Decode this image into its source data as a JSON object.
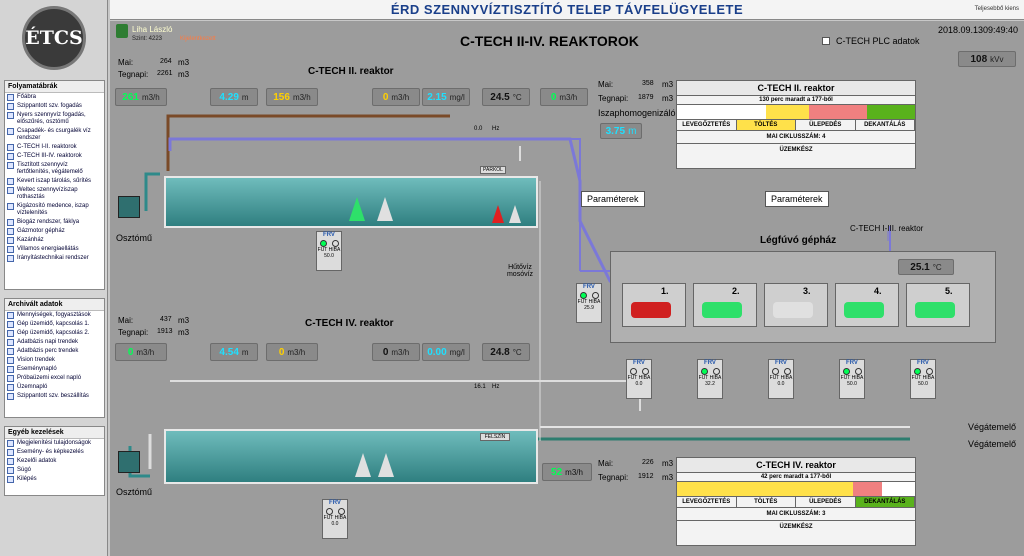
{
  "header": {
    "title": "ÉRD SZENNYVÍZTISZTÍTÓ TELEP TÁVFELÜGYELETE",
    "logout": "Teljesebbő kiens"
  },
  "sidebar": {
    "logo": "ÉTCS",
    "flow": {
      "title": "Folyamatábrák",
      "items": [
        "Főábra",
        "Szippantott szv. fogadás",
        "Nyers szennyvíz fogadás, előszűrés, osztómű",
        "Csapadék- és csurgalék víz rendszer",
        "C-TECH I-II. reaktorok",
        "C-TECH III-IV. reaktorok",
        "Tisztított szennyvíz fertőtlenítés, végátemelő",
        "Kevert iszap tárolás, sűrítés",
        "Weltec szennyvíziszap rothasztás",
        "Kigázosító medence, iszap víztelenítés",
        "Biogáz rendszer, fáklya",
        "Gázmotor gépház",
        "Kazánház",
        "Villamos energiaellátás",
        "Irányítástechnikai rendszer"
      ]
    },
    "archive": {
      "title": "Archivált adatok",
      "items": [
        "Mennyiségek, fogyasztások",
        "Gép üzemidő, kapcsolás 1.",
        "Gép üzemidő, kapcsolás 2.",
        "Adatbázis napi trendek",
        "Adatbázis perc trendek",
        "Vision trendek",
        "Eseménynapló",
        "Próbaüzemi excel napló",
        "Üzemnapló",
        "Szippantott szv. beszállítás"
      ]
    },
    "other": {
      "title": "Egyéb kezelések",
      "items": [
        "Megjelenítési tulajdonságok",
        "Esemény- és képkezelés",
        "Kezelői adatok",
        "Súgó",
        "Kilépés"
      ]
    }
  },
  "top": {
    "user": "Liha László",
    "level": "Szint: 4223",
    "status": "Kijelentkezett",
    "screen_title": "C-TECH II-IV. REAKTOROK",
    "plc_label": "C-TECH PLC adatok",
    "date": "2018.09.13",
    "time": "09:49:40",
    "power": "108",
    "power_unit": "kVv"
  },
  "r2": {
    "title": "C-TECH II. reaktor",
    "mai_label": "Mai:",
    "mai": "264",
    "teg_label": "Tegnapi:",
    "teg": "2261",
    "unit": "m3",
    "readouts": [
      {
        "v": "261",
        "u": "m3/h",
        "c": "green"
      },
      {
        "v": "4.29",
        "u": "m",
        "c": "cyan"
      },
      {
        "v": "156",
        "u": "m3/h",
        "c": "yellow"
      },
      {
        "v": "0",
        "u": "m3/h",
        "c": "yellow"
      },
      {
        "v": "2.15",
        "u": "mg/l",
        "c": "cyan"
      },
      {
        "v": "24.5",
        "u": "°C",
        "c": "dark"
      },
      {
        "v": "0",
        "u": "m3/h",
        "c": "green"
      }
    ],
    "hz": "0.0",
    "hz_u": "Hz",
    "parkol": "PARKOL",
    "frv": "FRV",
    "fut": "FUT",
    "hiba": "HIBA",
    "frv_hz": "50.0",
    "osztomu": "Osztómű",
    "hutoviz": "Hűtővíz mosóvíz"
  },
  "r4": {
    "title": "C-TECH IV. reaktor",
    "mai_label": "Mai:",
    "mai": "437",
    "teg_label": "Tegnapi:",
    "teg": "1913",
    "unit": "m3",
    "readouts": [
      {
        "v": "0",
        "u": "m3/h",
        "c": "green"
      },
      {
        "v": "4.54",
        "u": "m",
        "c": "cyan"
      },
      {
        "v": "0",
        "u": "m3/h",
        "c": "yellow"
      },
      {
        "v": "0",
        "u": "m3/h",
        "c": "dark"
      },
      {
        "v": "0.00",
        "u": "mg/l",
        "c": "cyan"
      },
      {
        "v": "24.8",
        "u": "°C",
        "c": "dark"
      }
    ],
    "hz": "16.1",
    "hz_u": "Hz",
    "felszin": "FELSZÍN",
    "frv": "FRV",
    "fut": "FUT",
    "hiba": "HIBA",
    "frv_hz": "0.0",
    "osztomu": "Osztómű"
  },
  "iszap": {
    "mai_label": "Mai:",
    "mai": "358",
    "teg_label": "Tegnapi:",
    "teg": "1879",
    "unit": "m3",
    "label": "Iszaphomogenizáló",
    "level": "3.75",
    "lu": "m"
  },
  "out": {
    "mai_label": "Mai:",
    "mai": "226",
    "teg_label": "Tegnapi:",
    "teg": "1912",
    "unit": "m3",
    "flow": "52",
    "fu": "m3/h",
    "vegatemelo1": "Végátemelő",
    "vegatemelo2": "Végátemelő"
  },
  "ctl2": {
    "title": "C-TECH II. reaktor",
    "remain": "130 perc maradt a 177-ből",
    "phases": [
      "LEVEGŐZTETÉS",
      "TÖLTÉS",
      "ÜLEPEDÉS",
      "DEKANTÁLÁS"
    ],
    "cycle": "MAI CIKLUSSZÁM: 4",
    "mode": "ÜZEMKÉSZ"
  },
  "ctl4": {
    "title": "C-TECH IV. reaktor",
    "remain": "42 perc maradt a 177-ből",
    "phases": [
      "LEVEGŐZTETÉS",
      "TÖLTÉS",
      "ÜLEPEDÉS",
      "DEKANTÁLÁS"
    ],
    "cycle": "MAI CIKLUSSZÁM: 3",
    "mode": "ÜZEMKÉSZ"
  },
  "param": "Paraméterek",
  "blower": {
    "title": "Légfúvó gépház",
    "link": "C-TECH I-III. reaktor",
    "temp": "25.1",
    "tu": "°C",
    "frv": "FRV",
    "fut": "FUT",
    "hiba": "HIBA",
    "frv_hz": "25.9",
    "units": [
      {
        "n": "1.",
        "hz": "0.0"
      },
      {
        "n": "2.",
        "hz": "32.2"
      },
      {
        "n": "3.",
        "hz": "0.0"
      },
      {
        "n": "4.",
        "hz": "50.0"
      },
      {
        "n": "5.",
        "hz": "50.0"
      }
    ]
  },
  "colors": {
    "green": "#00ff55",
    "cyan": "#1fe0ff",
    "yellow": "#ffd000",
    "pink": "#f08080",
    "tolt": "#ffe14a",
    "dek": "#59b21c"
  }
}
